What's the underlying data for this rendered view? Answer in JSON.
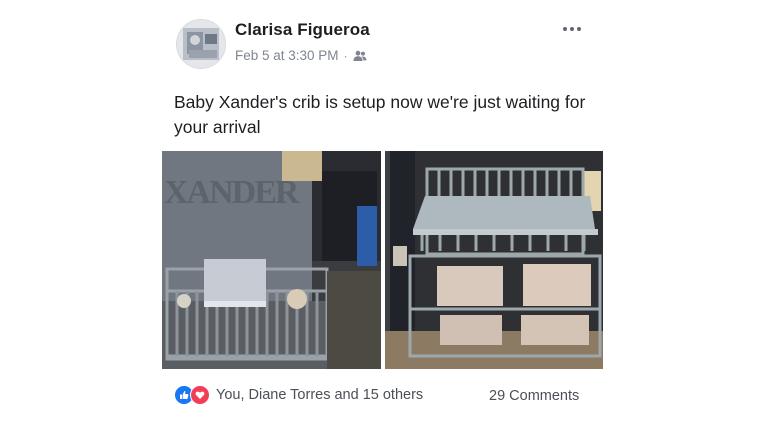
{
  "post": {
    "author": "Clarisa Figueroa",
    "timestamp": "Feb 5 at 3:30 PM",
    "separator": "·",
    "audience_icon": "friends-icon",
    "text": "Baby Xander's crib is setup now we're just waiting for your arrival",
    "photos": [
      {
        "wall_letters": "XANDER",
        "description_icon": "photo"
      },
      {
        "description_icon": "photo"
      }
    ],
    "reactions": {
      "icons": [
        "like-icon",
        "love-icon"
      ],
      "summary": "You, Diane Torres and 15 others"
    },
    "comments": "29 Comments"
  },
  "colors": {
    "like": "#1877f2",
    "love": "#f33e58",
    "secondary_text": "#7f8591"
  }
}
